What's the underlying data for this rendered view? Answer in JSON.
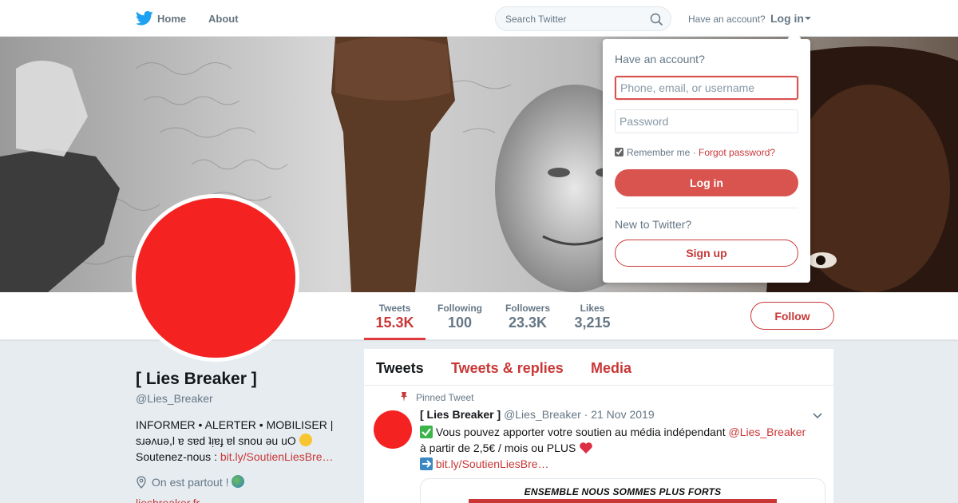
{
  "topnav": {
    "brand_icon": "twitter-bird-icon",
    "home_label": "Home",
    "about_label": "About",
    "search_placeholder": "Search Twitter",
    "search_icon": "search-icon",
    "have_account": "Have an account?",
    "login_label": "Log in",
    "accent_color": "#1da1f2"
  },
  "banner": {
    "description_icon": "header-photo"
  },
  "stats": [
    {
      "label": "Tweets",
      "value": "15.3K"
    },
    {
      "label": "Following",
      "value": "100"
    },
    {
      "label": "Followers",
      "value": "23.3K"
    },
    {
      "label": "Likes",
      "value": "3,215"
    }
  ],
  "follow_label": "Follow",
  "profile": {
    "name": "[ Lies Breaker ]",
    "handle": "@Lies_Breaker",
    "bio_line1": "INFORMER • ALERTER • MOBILISER |",
    "bio_line2": "sɹǝʌuǝ,l ɐ sɐd ʇᴉɐɟ ɐl snou ǝu uO",
    "bio_line3_prefix": "Soutenez-nous : ",
    "bio_link": "bit.ly/SoutienLiesBre…",
    "location": "On est partout !",
    "url": "liesbreaker.fr",
    "avatar_color": "#f52222"
  },
  "timeline": {
    "tabs": [
      "Tweets",
      "Tweets & replies",
      "Media"
    ],
    "pinned_label": "Pinned Tweet",
    "tweet": {
      "name": "[ Lies Breaker ]",
      "handle": "@Lies_Breaker",
      "date": "· 21 Nov 2019",
      "line1_text": " Vous pouvez apporter votre soutien au média indépendant ",
      "line1_mention": "@Lies_Breaker",
      "line2_text": " à partir de 2,5€ / mois ou PLUS ",
      "line3_link": "bit.ly/SoutienLiesBre…",
      "media_caption": "ENSEMBLE NOUS SOMMES PLUS FORTS"
    }
  },
  "login_dropdown": {
    "title": "Have an account?",
    "username_placeholder": "Phone, email, or username",
    "password_placeholder": "Password",
    "remember_label": "Remember me",
    "separator": " · ",
    "forgot_label": "Forgot password?",
    "login_button": "Log in",
    "new_label": "New to Twitter?",
    "signup_button": "Sign up",
    "primary_color": "#d9534f"
  }
}
